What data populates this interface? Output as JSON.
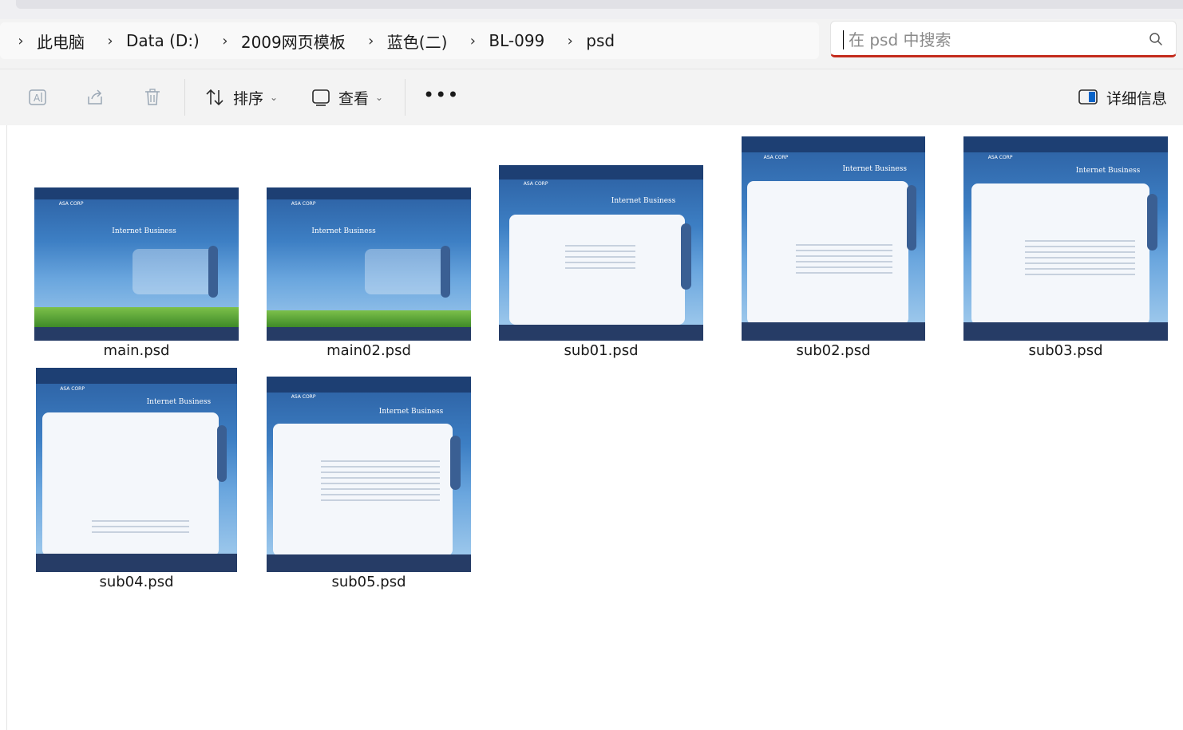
{
  "breadcrumb": {
    "items": [
      "此电脑",
      "Data (D:)",
      "2009网页模板",
      "蓝色(二)",
      "BL-099",
      "psd"
    ]
  },
  "search": {
    "placeholder": "在 psd 中搜索",
    "value": ""
  },
  "toolbar": {
    "sort_label": "排序",
    "view_label": "查看",
    "more_label": "•••",
    "details_label": "详细信息"
  },
  "files": [
    {
      "name": "main.psd"
    },
    {
      "name": "main02.psd"
    },
    {
      "name": "sub01.psd"
    },
    {
      "name": "sub02.psd"
    },
    {
      "name": "sub03.psd"
    },
    {
      "name": "sub04.psd"
    },
    {
      "name": "sub05.psd"
    }
  ],
  "thumbnail_text": {
    "logo": "ASA CORP",
    "headline": "Internet Business"
  },
  "colors": {
    "search_focus": "#c42b1c",
    "thumb_blue": "#2f67a8",
    "footer_navy": "#263c66"
  },
  "icons": [
    "rename-icon",
    "share-icon",
    "delete-icon",
    "sort-icon",
    "view-icon",
    "details-pane-icon",
    "search-icon",
    "chevron-right-icon",
    "chevron-down-icon"
  ]
}
